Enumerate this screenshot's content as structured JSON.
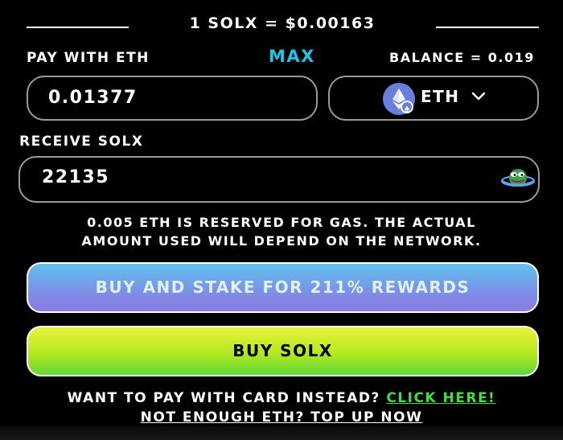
{
  "header": {
    "price_text": "1 SOLX = $0.00163"
  },
  "pay": {
    "label": "PAY WITH ETH",
    "max_label": "MAX",
    "balance_text": "BALANCE = 0.019",
    "amount_value": "0.01377"
  },
  "currency_select": {
    "selected": "ETH",
    "icon": "ethereum-icon"
  },
  "receive": {
    "label": "RECEIVE SOLX",
    "value": "22135",
    "icon": "pepe-planet-icon"
  },
  "gas_note": {
    "line1": "0.005 ETH IS RESERVED FOR GAS. THE ACTUAL",
    "line2": "AMOUNT USED WILL DEPEND ON THE NETWORK."
  },
  "buttons": {
    "stake_label": "BUY AND STAKE FOR 211% REWARDS",
    "buy_label": "BUY SOLX"
  },
  "card": {
    "prompt": "WANT TO PAY WITH CARD INSTEAD?",
    "link": "CLICK HERE!"
  },
  "topup": {
    "link": "NOT ENOUGH ETH? TOP UP NOW"
  },
  "colors": {
    "accent_blue": "#1ec3ea",
    "link_green": "#3fe040",
    "stake_gradient": [
      "#5fc3ee",
      "#8c7ae2"
    ],
    "buy_gradient": [
      "#e8f43b",
      "#61d73b"
    ]
  }
}
